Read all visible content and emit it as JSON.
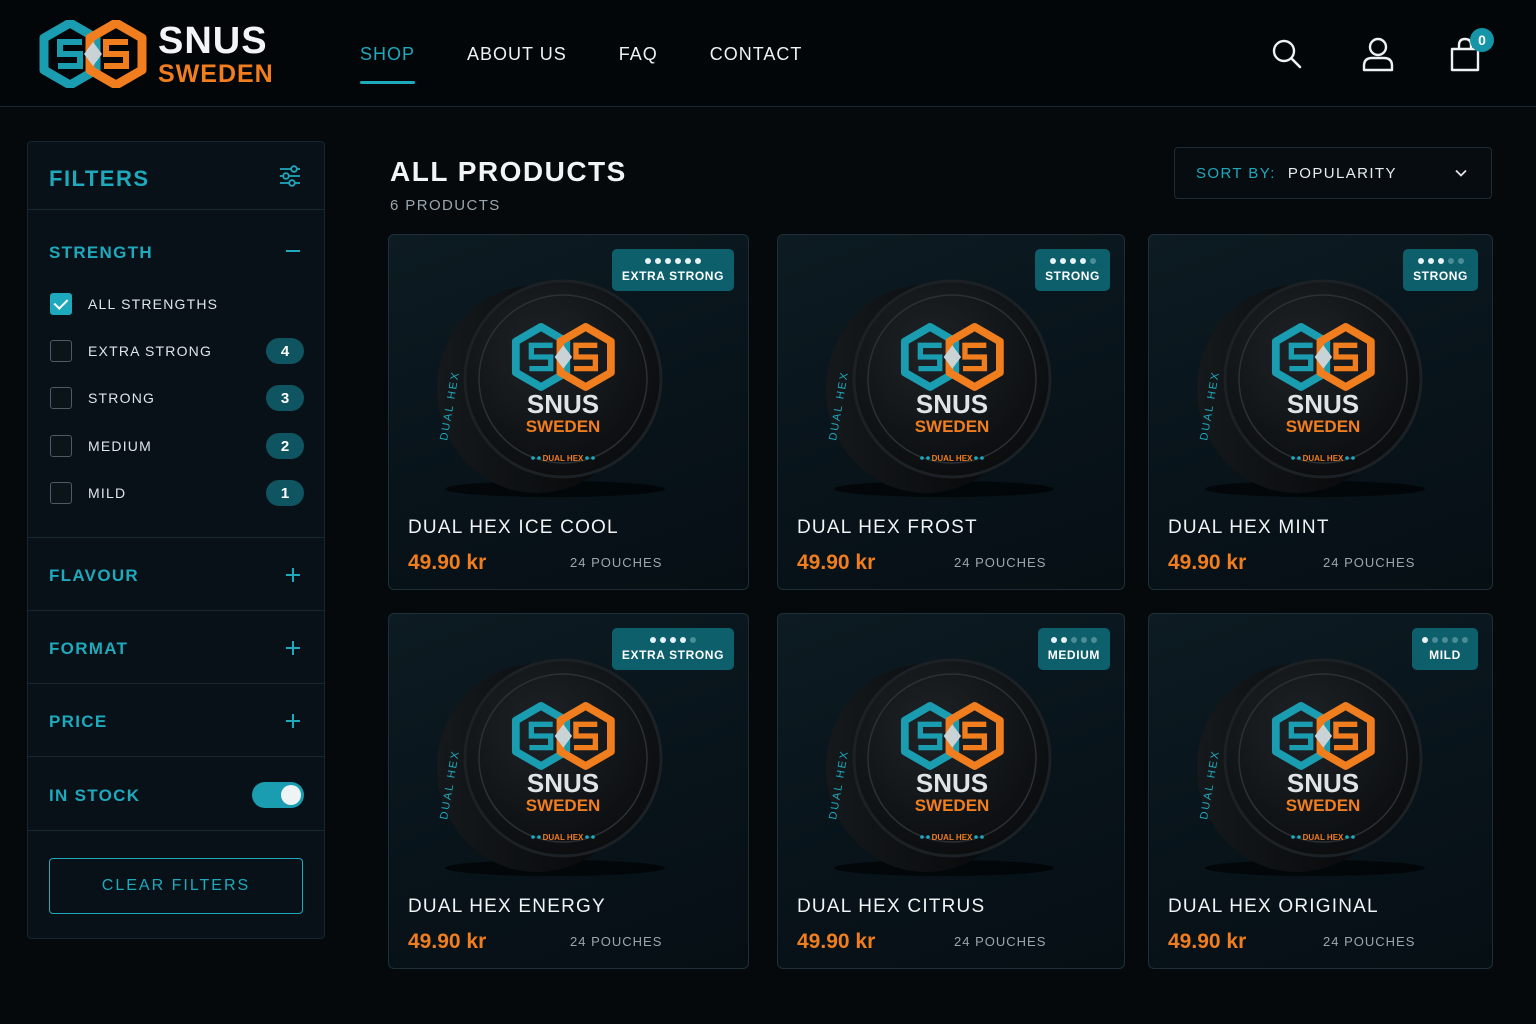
{
  "brand": {
    "line1": "SNUS",
    "line2": "SWEDEN"
  },
  "nav": [
    "SHOP",
    "ABOUT US",
    "FAQ",
    "CONTACT"
  ],
  "cart_count": "0",
  "filters": {
    "title": "FILTERS",
    "strength": {
      "title": "STRENGTH",
      "options": [
        {
          "label": "ALL STRENGTHS",
          "count": "",
          "checked": true
        },
        {
          "label": "EXTRA STRONG",
          "count": "4",
          "checked": false
        },
        {
          "label": "STRONG",
          "count": "3",
          "checked": false
        },
        {
          "label": "MEDIUM",
          "count": "2",
          "checked": false
        },
        {
          "label": "MILD",
          "count": "1",
          "checked": false
        }
      ]
    },
    "flavour": "FLAVOUR",
    "format": "FORMAT",
    "price": "PRICE",
    "in_stock": {
      "label": "IN STOCK",
      "enabled": true
    },
    "clear": "CLEAR FILTERS"
  },
  "main": {
    "title": "ALL PRODUCTS",
    "count": "6 PRODUCTS",
    "sort": {
      "label": "SORT BY:",
      "value": "POPULARITY"
    }
  },
  "tin_print": {
    "brand1": "SNUS",
    "brand2": "SWEDEN",
    "sub": "DUAL HEX",
    "rim": "DUAL HEX"
  },
  "products": [
    {
      "name": "DUAL HEX ICE COOL",
      "price": "49.90 kr",
      "pouches": "24 POUCHES",
      "badge": "EXTRA STRONG",
      "strength_dots": 6,
      "dots_total": 6
    },
    {
      "name": "DUAL HEX FROST",
      "price": "49.90 kr",
      "pouches": "24 POUCHES",
      "badge": "STRONG",
      "strength_dots": 4,
      "dots_total": 5
    },
    {
      "name": "DUAL HEX MINT",
      "price": "49.90 kr",
      "pouches": "24 POUCHES",
      "badge": "STRONG",
      "strength_dots": 3,
      "dots_total": 5
    },
    {
      "name": "DUAL HEX ENERGY",
      "price": "49.90 kr",
      "pouches": "24 POUCHES",
      "badge": "EXTRA STRONG",
      "strength_dots": 4,
      "dots_total": 5
    },
    {
      "name": "DUAL HEX CITRUS",
      "price": "49.90 kr",
      "pouches": "24 POUCHES",
      "badge": "MEDIUM",
      "strength_dots": 2,
      "dots_total": 5
    },
    {
      "name": "DUAL HEX ORIGINAL",
      "price": "49.90 kr",
      "pouches": "24 POUCHES",
      "badge": "MILD",
      "strength_dots": 1,
      "dots_total": 5
    }
  ],
  "colors": {
    "accent": "#1fa9bd",
    "brand_orange": "#f07d1e",
    "background": "#05090c"
  },
  "icons": [
    "search-icon",
    "user-icon",
    "bag-icon",
    "sliders-icon",
    "chevron-down-icon",
    "plus-icon",
    "minus-icon",
    "check-icon"
  ]
}
